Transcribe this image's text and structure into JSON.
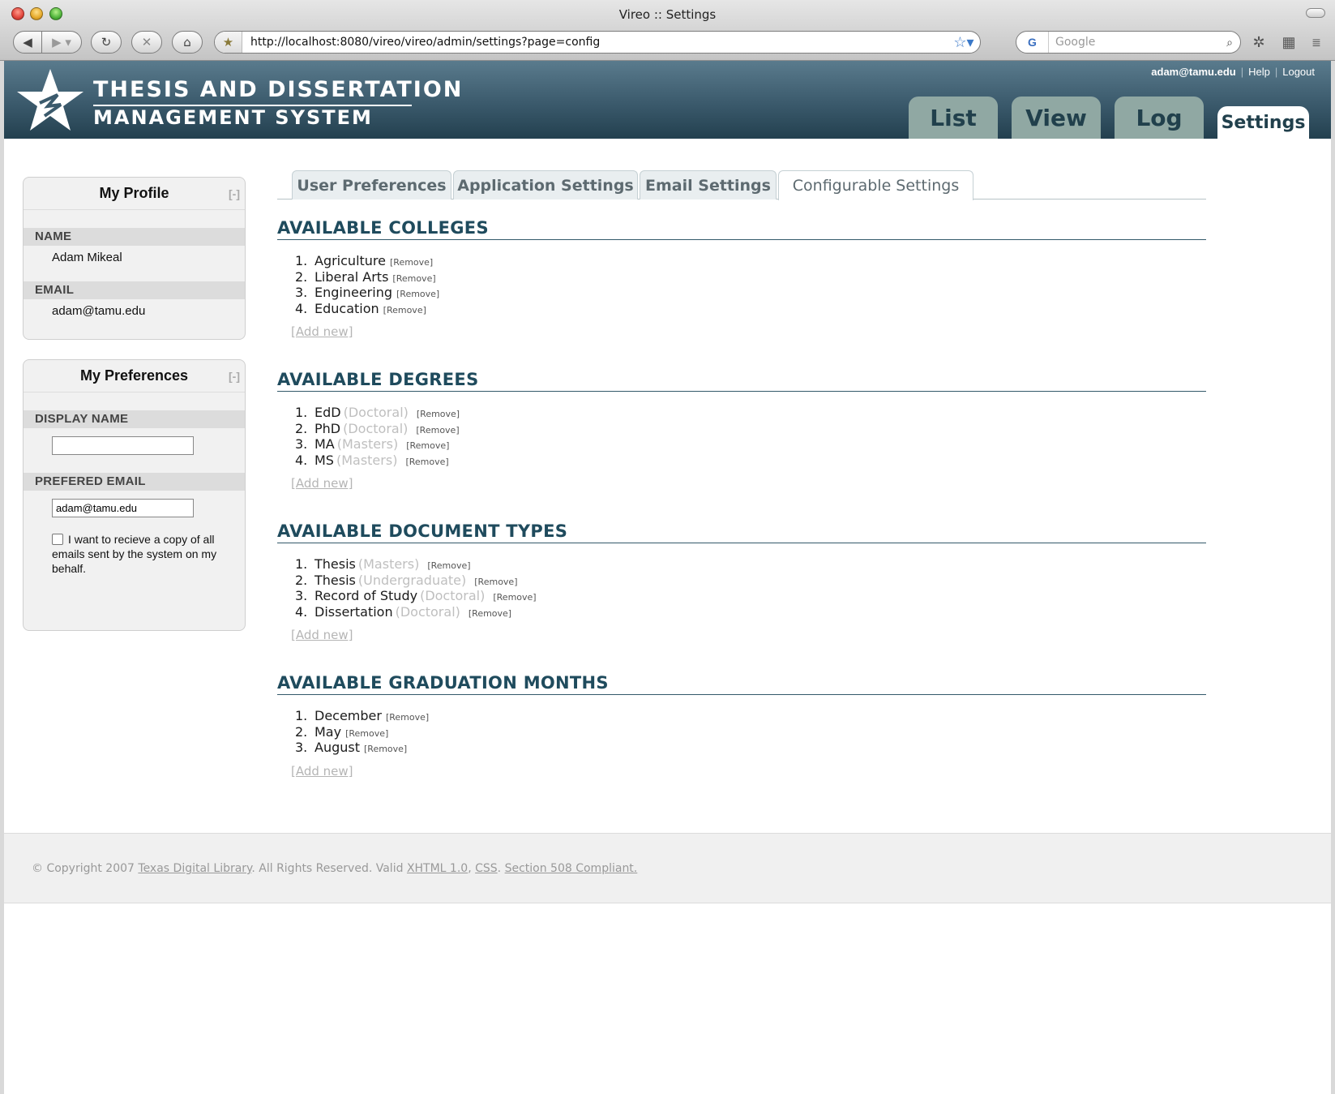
{
  "browser": {
    "window_title": "Vireo :: Settings",
    "url": "http://localhost:8080/vireo/vireo/admin/settings?page=config",
    "search_placeholder": "Google",
    "search_engine_glyph": "G"
  },
  "header": {
    "logo_line1": "THESIS AND DISSERTATION",
    "logo_line2": "MANAGEMENT SYSTEM",
    "user": "adam@tamu.edu",
    "help": "Help",
    "logout": "Logout",
    "tabs": [
      {
        "label": "List"
      },
      {
        "label": "View"
      },
      {
        "label": "Log"
      },
      {
        "label": "Settings",
        "active": true
      }
    ]
  },
  "profile": {
    "title": "My Profile",
    "collapse": "[-]",
    "name_label": "NAME",
    "name": "Adam Mikeal",
    "email_label": "EMAIL",
    "email": "adam@tamu.edu"
  },
  "preferences": {
    "title": "My Preferences",
    "collapse": "[-]",
    "display_name_label": "DISPLAY NAME",
    "display_name_value": "",
    "preferred_email_label": "PREFERED EMAIL",
    "preferred_email_value": "adam@tamu.edu",
    "copy_checkbox_label": "I want to recieve a copy of all emails sent by the system on my behalf.",
    "copy_checked": false
  },
  "settings_tabs": [
    {
      "label": "User Preferences"
    },
    {
      "label": "Application Settings"
    },
    {
      "label": "Email Settings"
    },
    {
      "label": "Configurable Settings",
      "active": true
    }
  ],
  "sections": {
    "remove_label": "[Remove]",
    "add_new_label": "[Add new]",
    "colleges": {
      "title": "AVAILABLE COLLEGES",
      "items": [
        {
          "num": "1.",
          "name": "Agriculture"
        },
        {
          "num": "2.",
          "name": "Liberal Arts"
        },
        {
          "num": "3.",
          "name": "Engineering"
        },
        {
          "num": "4.",
          "name": "Education"
        }
      ]
    },
    "degrees": {
      "title": "AVAILABLE DEGREES",
      "items": [
        {
          "num": "1.",
          "name": "EdD",
          "qualifier": "(Doctoral)"
        },
        {
          "num": "2.",
          "name": "PhD",
          "qualifier": "(Doctoral)"
        },
        {
          "num": "3.",
          "name": "MA",
          "qualifier": "(Masters)"
        },
        {
          "num": "4.",
          "name": "MS",
          "qualifier": "(Masters)"
        }
      ]
    },
    "doc_types": {
      "title": "AVAILABLE DOCUMENT TYPES",
      "items": [
        {
          "num": "1.",
          "name": "Thesis",
          "qualifier": "(Masters)"
        },
        {
          "num": "2.",
          "name": "Thesis",
          "qualifier": "(Undergraduate)"
        },
        {
          "num": "3.",
          "name": "Record of Study",
          "qualifier": "(Doctoral)"
        },
        {
          "num": "4.",
          "name": "Dissertation",
          "qualifier": "(Doctoral)"
        }
      ]
    },
    "months": {
      "title": "AVAILABLE GRADUATION MONTHS",
      "items": [
        {
          "num": "1.",
          "name": "December"
        },
        {
          "num": "2.",
          "name": "May"
        },
        {
          "num": "3.",
          "name": "August"
        }
      ]
    }
  },
  "footer": {
    "copyright": "© Copyright 2007",
    "tdl_link": "Texas Digital Library",
    "rights": ". All Rights Reserved. Valid",
    "xhtml_link": "XHTML 1.0",
    "comma": ",",
    "css_link": "CSS",
    "period": ".",
    "s508_link": "Section 508 Compliant."
  },
  "colors": {
    "header_top": "#5a7b8d",
    "header_bottom": "#23404f",
    "tab_inactive": "#90a8a3",
    "section_title": "#1f4b5d",
    "qualifier_gray": "#bfbfbf"
  }
}
